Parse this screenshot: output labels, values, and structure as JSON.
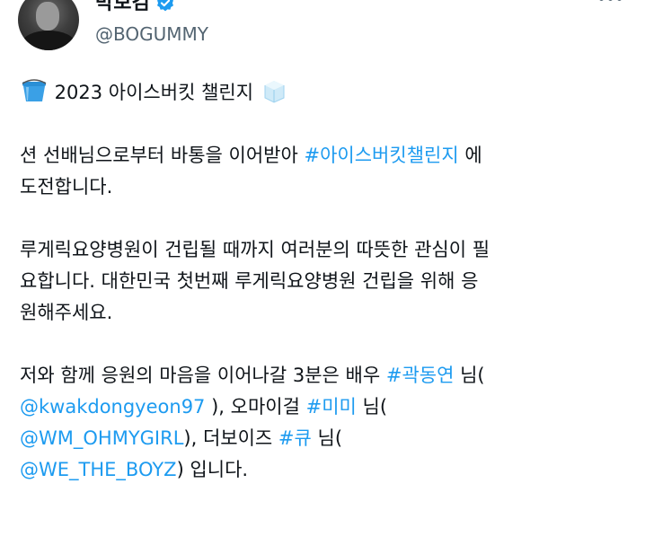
{
  "header": {
    "display_name": "박보검",
    "handle": "@BOGUMMY",
    "verified_icon": "verified-badge-icon",
    "more_icon": "more-options-icon"
  },
  "tweet": {
    "title_icon_left": "bucket-emoji",
    "title_text": " 2023 아이스버킷 챌린지 ",
    "title_icon_right": "ice-cube-emoji",
    "p1": {
      "a": "션 선배님으로부터 바통을 이어받아 ",
      "hashtag": "#아이스버킷챌린지",
      "b": " 에",
      "c": "도전합니다."
    },
    "p2": {
      "l1": "루게릭요양병원이 건립될 때까지 여러분의 따뜻한 관심이 필",
      "l2": "요합니다. 대한민국 첫번째 루게릭요양병원 건립을 위해 응",
      "l3": "원해주세요."
    },
    "p3": {
      "a": "저와 함께 응원의 마음을 이어나갈 3분은 배우 ",
      "tag1": "#곽동연",
      "b": " 님(",
      "mention1": "@kwakdongyeon97",
      "c": " ), 오마이걸 ",
      "tag2": "#미미",
      "d": " 님(",
      "mention2": "@WM_OHMYGIRL",
      "e": "), 더보이즈 ",
      "tag3": "#큐",
      "f": " 님(",
      "mention3": "@WE_THE_BOYZ",
      "g": ") 입니다."
    }
  },
  "colors": {
    "link": "#1d9bf0",
    "secondary_text": "#536471",
    "text": "#0f1419",
    "verified": "#1d9bf0"
  }
}
